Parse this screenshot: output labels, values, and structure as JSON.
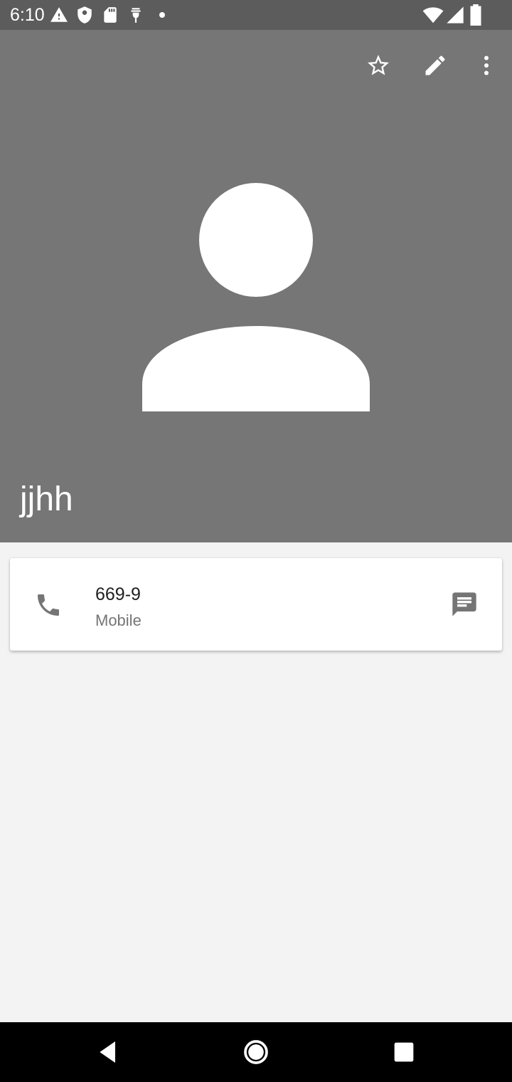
{
  "status_bar": {
    "time": "6:10",
    "left_icons": [
      "warning-icon",
      "shield-icon",
      "sd-card-icon",
      "usb-icon",
      "dot-icon"
    ],
    "right_icons": [
      "wifi-icon",
      "cell-signal-icon",
      "battery-icon"
    ]
  },
  "header": {
    "background": "#767676",
    "actions": [
      "star-outline-icon",
      "edit-pencil-icon",
      "more-vert-icon"
    ],
    "contact_name": "jjhh"
  },
  "phone_card": {
    "number": "669-9",
    "type_label": "Mobile",
    "leading_icon": "phone-icon",
    "trailing_icon": "message-icon"
  },
  "nav_bar": {
    "buttons": [
      "back-icon",
      "home-icon",
      "recents-icon"
    ]
  }
}
